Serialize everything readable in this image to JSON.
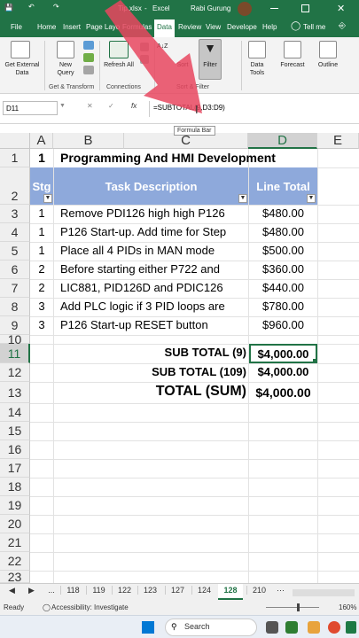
{
  "title_bar": {
    "filename": "Tip.xlsx",
    "separator": "-",
    "app": "Excel",
    "user": "Rabi Gurung"
  },
  "menu": [
    "File",
    "Home",
    "Insert",
    "Page Layo",
    "Formulas",
    "Data",
    "Review",
    "View",
    "Develope",
    "Help",
    "Tell me"
  ],
  "ribbon": {
    "get_external": "Get External Data",
    "new_query": "New Query",
    "refresh_all": "Refresh All",
    "sort": "Sort",
    "filter": "Filter",
    "data_tools": "Data Tools",
    "forecast": "Forecast",
    "outline": "Outline",
    "group_get": "Get & Transform",
    "group_conn": "Connections",
    "group_sort": "Sort & Filter"
  },
  "formula_bar": {
    "name_box": "D11",
    "fx": "fx",
    "formula": "=SUBTOTAL(9,D3:D9)",
    "tooltip": "Formula Bar"
  },
  "columns": [
    "A",
    "B",
    "C",
    "D",
    "E"
  ],
  "rows": [
    "1",
    "2",
    "3",
    "4",
    "5",
    "6",
    "7",
    "8",
    "9",
    "10",
    "11",
    "12",
    "13",
    "14",
    "15",
    "16",
    "17",
    "18",
    "19",
    "20",
    "21",
    "22",
    "23"
  ],
  "sheet": {
    "row1": {
      "a": "1",
      "b": "Programming And HMI Development"
    },
    "headers": {
      "stg": "Stg",
      "task": "Task Description",
      "total": "Line Total"
    },
    "data": [
      {
        "stg": "1",
        "task": "Remove PDI126 high high P126",
        "total": "$480.00"
      },
      {
        "stg": "1",
        "task": "P126 Start-up. Add time for Step",
        "total": "$480.00"
      },
      {
        "stg": "1",
        "task": "Place all 4 PIDs in MAN mode",
        "total": "$500.00"
      },
      {
        "stg": "2",
        "task": "Before starting either P722 and",
        "total": "$360.00"
      },
      {
        "stg": "2",
        "task": "LIC881, PID126D and PDIC126",
        "total": "$440.00"
      },
      {
        "stg": "3",
        "task": "Add PLC logic if 3 PID loops are",
        "total": "$780.00"
      },
      {
        "stg": "3",
        "task": "P126 Start-up RESET button",
        "total": "$960.00"
      }
    ],
    "sub9_label": "SUB TOTAL (9)",
    "sub9_value": "$4,000.00",
    "sub109_label": "SUB TOTAL (109)",
    "sub109_value": "$4,000.00",
    "total_label": "TOTAL (SUM)",
    "total_value": "$4,000.00"
  },
  "tabs": [
    "...",
    "118",
    "119",
    "122",
    "123",
    "127",
    "124",
    "128",
    "210"
  ],
  "active_tab": "128",
  "status": {
    "ready": "Ready",
    "accessibility": "Accessibility: Investigate",
    "zoom": "160%"
  },
  "taskbar": {
    "search": "Search"
  },
  "colors": {
    "excel_green": "#217346",
    "header_fill": "#8ea9db",
    "arrow": "#e8475f"
  }
}
